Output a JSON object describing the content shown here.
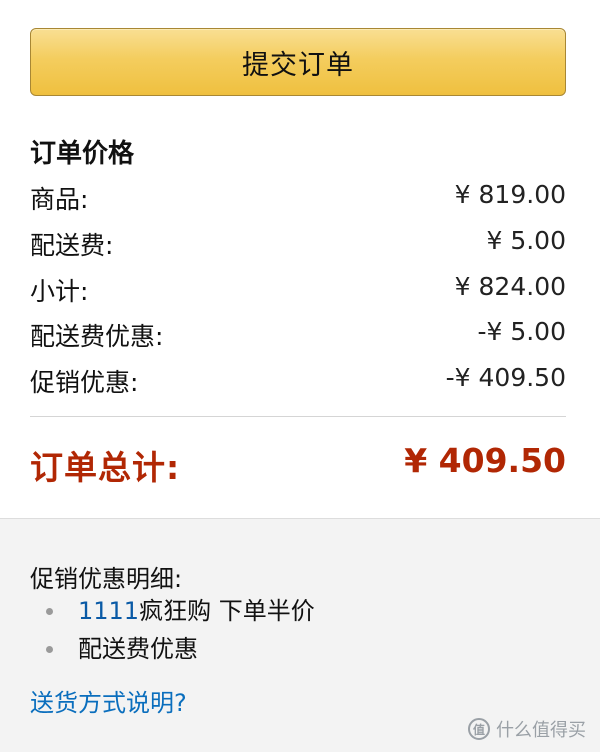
{
  "submit_button": {
    "label": "提交订单"
  },
  "order_summary": {
    "title": "订单价格",
    "rows": [
      {
        "label": "商品:",
        "value": "¥ 819.00"
      },
      {
        "label": "配送费:",
        "value": "¥ 5.00"
      },
      {
        "label": "小计:",
        "value": "¥ 824.00"
      },
      {
        "label": "配送费优惠:",
        "value": "-¥ 5.00"
      },
      {
        "label": "促销优惠:",
        "value": "-¥ 409.50"
      }
    ],
    "total_label": "订单总计:",
    "total_value": "¥ 409.50"
  },
  "promo_details": {
    "title": "促销优惠明细:",
    "items": [
      {
        "number": "1111",
        "text": "疯狂购 下单半价"
      },
      {
        "number": "",
        "text": "配送费优惠"
      }
    ]
  },
  "shipping_link": {
    "label": "送货方式说明?"
  },
  "watermark": {
    "icon": "值",
    "text": "什么值得买"
  },
  "colors": {
    "button": "#f4cd5e",
    "total": "#b12704",
    "link": "#0a6ebd",
    "panel_bg": "#f3f3f3"
  }
}
